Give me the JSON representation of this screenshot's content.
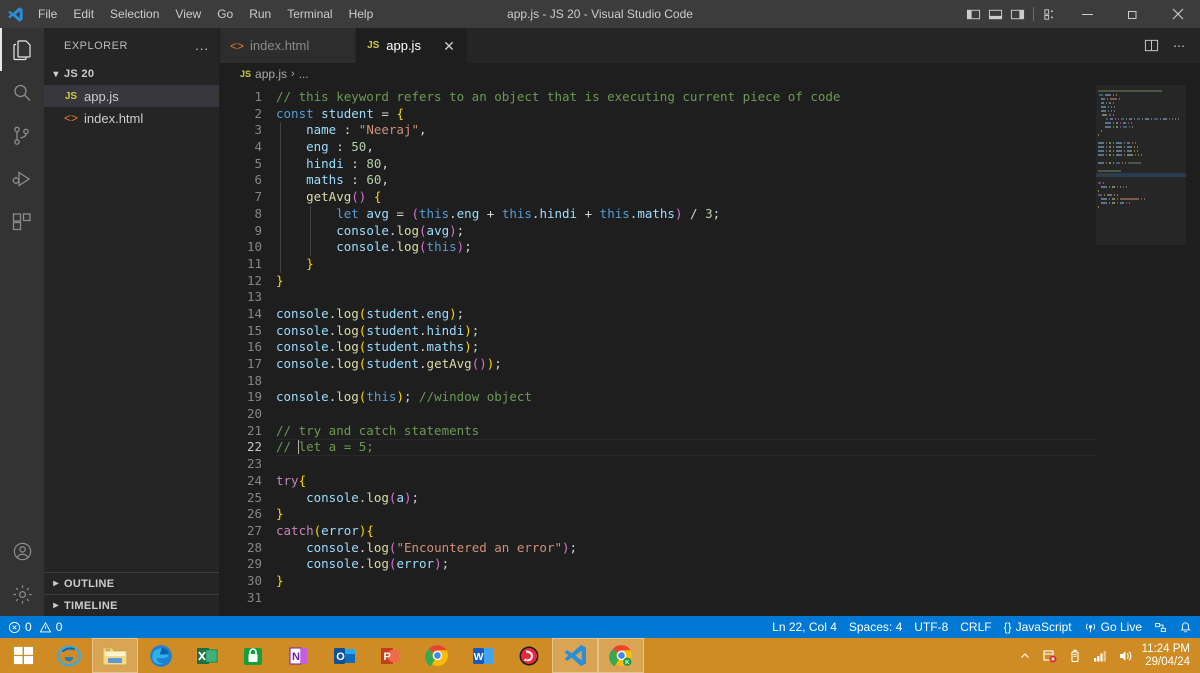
{
  "titlebar": {
    "window_title": "app.js - JS 20 - Visual Studio Code",
    "menus": [
      "File",
      "Edit",
      "Selection",
      "View",
      "Go",
      "Run",
      "Terminal",
      "Help"
    ],
    "layout_buttons": [
      {
        "name": "toggle-primary-sidebar",
        "label": "Toggle Primary Side Bar"
      },
      {
        "name": "toggle-panel",
        "label": "Toggle Panel"
      },
      {
        "name": "toggle-secondary-sidebar",
        "label": "Toggle Secondary Side Bar"
      },
      {
        "name": "customize-layout",
        "label": "Customize Layout"
      }
    ],
    "window_controls": [
      "minimize",
      "maximize",
      "close"
    ]
  },
  "activitybar": {
    "items": [
      {
        "name": "explorer",
        "label": "Explorer",
        "active": true
      },
      {
        "name": "search",
        "label": "Search",
        "active": false
      },
      {
        "name": "source-control",
        "label": "Source Control",
        "active": false
      },
      {
        "name": "run-and-debug",
        "label": "Run and Debug",
        "active": false
      },
      {
        "name": "extensions",
        "label": "Extensions",
        "active": false
      }
    ],
    "bottom": [
      {
        "name": "accounts",
        "label": "Accounts"
      },
      {
        "name": "manage",
        "label": "Manage"
      }
    ]
  },
  "sidebar": {
    "title": "EXPLORER",
    "more_actions": "...",
    "folder": {
      "label": "JS 20",
      "expanded": true
    },
    "files": [
      {
        "label": "app.js",
        "icon": "js",
        "selected": true
      },
      {
        "label": "index.html",
        "icon": "html",
        "selected": false
      }
    ],
    "collapsed_sections": [
      "OUTLINE",
      "TIMELINE"
    ]
  },
  "editor": {
    "tabs": [
      {
        "label": "index.html",
        "icon": "html",
        "active": false
      },
      {
        "label": "app.js",
        "icon": "js",
        "active": true
      }
    ],
    "tab_close": "✕",
    "actions": [
      {
        "name": "split-editor-right",
        "label": "Split Editor Right"
      },
      {
        "name": "more-actions",
        "label": "More Actions..."
      }
    ],
    "breadcrumb": [
      "app.js",
      "..."
    ],
    "total_lines": 31,
    "cursor_line": 22,
    "code_lines": [
      {
        "n": 1,
        "tokens": [
          {
            "t": "// this keyword refers to an object that is executing current piece of code",
            "c": "c-com"
          }
        ]
      },
      {
        "n": 2,
        "tokens": [
          {
            "t": "const",
            "c": "c-kw"
          },
          {
            "t": " "
          },
          {
            "t": "student",
            "c": "c-var"
          },
          {
            "t": " = ",
            "c": "c-op"
          },
          {
            "t": "{",
            "c": "c-b1"
          }
        ]
      },
      {
        "n": 3,
        "tokens": [
          {
            "t": "    "
          },
          {
            "t": "name",
            "c": "c-prop"
          },
          {
            "t": " : ",
            "c": "c-op"
          },
          {
            "t": "\"Neeraj\"",
            "c": "c-str"
          },
          {
            "t": ",",
            "c": "c-op"
          }
        ]
      },
      {
        "n": 4,
        "tokens": [
          {
            "t": "    "
          },
          {
            "t": "eng",
            "c": "c-prop"
          },
          {
            "t": " : ",
            "c": "c-op"
          },
          {
            "t": "50",
            "c": "c-num"
          },
          {
            "t": ",",
            "c": "c-op"
          }
        ]
      },
      {
        "n": 5,
        "tokens": [
          {
            "t": "    "
          },
          {
            "t": "hindi",
            "c": "c-prop"
          },
          {
            "t": " : ",
            "c": "c-op"
          },
          {
            "t": "80",
            "c": "c-num"
          },
          {
            "t": ",",
            "c": "c-op"
          }
        ]
      },
      {
        "n": 6,
        "tokens": [
          {
            "t": "    "
          },
          {
            "t": "maths",
            "c": "c-prop"
          },
          {
            "t": " : ",
            "c": "c-op"
          },
          {
            "t": "60",
            "c": "c-num"
          },
          {
            "t": ",",
            "c": "c-op"
          }
        ]
      },
      {
        "n": 7,
        "tokens": [
          {
            "t": "    "
          },
          {
            "t": "getAvg",
            "c": "c-fn"
          },
          {
            "t": "()",
            "c": "c-b2"
          },
          {
            "t": " "
          },
          {
            "t": "{",
            "c": "c-b1"
          }
        ]
      },
      {
        "n": 8,
        "tokens": [
          {
            "t": "        "
          },
          {
            "t": "let",
            "c": "c-kw"
          },
          {
            "t": " "
          },
          {
            "t": "avg",
            "c": "c-var"
          },
          {
            "t": " = ",
            "c": "c-op"
          },
          {
            "t": "(",
            "c": "c-b2"
          },
          {
            "t": "this",
            "c": "c-this"
          },
          {
            "t": ".",
            "c": "c-op"
          },
          {
            "t": "eng",
            "c": "c-prop"
          },
          {
            "t": " + ",
            "c": "c-op"
          },
          {
            "t": "this",
            "c": "c-this"
          },
          {
            "t": ".",
            "c": "c-op"
          },
          {
            "t": "hindi",
            "c": "c-prop"
          },
          {
            "t": " + ",
            "c": "c-op"
          },
          {
            "t": "this",
            "c": "c-this"
          },
          {
            "t": ".",
            "c": "c-op"
          },
          {
            "t": "maths",
            "c": "c-prop"
          },
          {
            "t": ")",
            "c": "c-b2"
          },
          {
            "t": " / ",
            "c": "c-op"
          },
          {
            "t": "3",
            "c": "c-num"
          },
          {
            "t": ";",
            "c": "c-op"
          }
        ]
      },
      {
        "n": 9,
        "tokens": [
          {
            "t": "        "
          },
          {
            "t": "console",
            "c": "c-var"
          },
          {
            "t": ".",
            "c": "c-op"
          },
          {
            "t": "log",
            "c": "c-fn"
          },
          {
            "t": "(",
            "c": "c-b2"
          },
          {
            "t": "avg",
            "c": "c-var"
          },
          {
            "t": ")",
            "c": "c-b2"
          },
          {
            "t": ";",
            "c": "c-op"
          }
        ]
      },
      {
        "n": 10,
        "tokens": [
          {
            "t": "        "
          },
          {
            "t": "console",
            "c": "c-var"
          },
          {
            "t": ".",
            "c": "c-op"
          },
          {
            "t": "log",
            "c": "c-fn"
          },
          {
            "t": "(",
            "c": "c-b2"
          },
          {
            "t": "this",
            "c": "c-this"
          },
          {
            "t": ")",
            "c": "c-b2"
          },
          {
            "t": ";",
            "c": "c-op"
          }
        ]
      },
      {
        "n": 11,
        "tokens": [
          {
            "t": "    "
          },
          {
            "t": "}",
            "c": "c-b1"
          }
        ]
      },
      {
        "n": 12,
        "tokens": [
          {
            "t": "}",
            "c": "c-b1"
          }
        ]
      },
      {
        "n": 13,
        "tokens": [
          {
            "t": ""
          }
        ]
      },
      {
        "n": 14,
        "tokens": [
          {
            "t": "console",
            "c": "c-var"
          },
          {
            "t": ".",
            "c": "c-op"
          },
          {
            "t": "log",
            "c": "c-fn"
          },
          {
            "t": "(",
            "c": "c-b1"
          },
          {
            "t": "student",
            "c": "c-var"
          },
          {
            "t": ".",
            "c": "c-op"
          },
          {
            "t": "eng",
            "c": "c-prop"
          },
          {
            "t": ")",
            "c": "c-b1"
          },
          {
            "t": ";",
            "c": "c-op"
          }
        ]
      },
      {
        "n": 15,
        "tokens": [
          {
            "t": "console",
            "c": "c-var"
          },
          {
            "t": ".",
            "c": "c-op"
          },
          {
            "t": "log",
            "c": "c-fn"
          },
          {
            "t": "(",
            "c": "c-b1"
          },
          {
            "t": "student",
            "c": "c-var"
          },
          {
            "t": ".",
            "c": "c-op"
          },
          {
            "t": "hindi",
            "c": "c-prop"
          },
          {
            "t": ")",
            "c": "c-b1"
          },
          {
            "t": ";",
            "c": "c-op"
          }
        ]
      },
      {
        "n": 16,
        "tokens": [
          {
            "t": "console",
            "c": "c-var"
          },
          {
            "t": ".",
            "c": "c-op"
          },
          {
            "t": "log",
            "c": "c-fn"
          },
          {
            "t": "(",
            "c": "c-b1"
          },
          {
            "t": "student",
            "c": "c-var"
          },
          {
            "t": ".",
            "c": "c-op"
          },
          {
            "t": "maths",
            "c": "c-prop"
          },
          {
            "t": ")",
            "c": "c-b1"
          },
          {
            "t": ";",
            "c": "c-op"
          }
        ]
      },
      {
        "n": 17,
        "tokens": [
          {
            "t": "console",
            "c": "c-var"
          },
          {
            "t": ".",
            "c": "c-op"
          },
          {
            "t": "log",
            "c": "c-fn"
          },
          {
            "t": "(",
            "c": "c-b1"
          },
          {
            "t": "student",
            "c": "c-var"
          },
          {
            "t": ".",
            "c": "c-op"
          },
          {
            "t": "getAvg",
            "c": "c-fn"
          },
          {
            "t": "()",
            "c": "c-b2"
          },
          {
            "t": ")",
            "c": "c-b1"
          },
          {
            "t": ";",
            "c": "c-op"
          }
        ]
      },
      {
        "n": 18,
        "tokens": [
          {
            "t": ""
          }
        ]
      },
      {
        "n": 19,
        "tokens": [
          {
            "t": "console",
            "c": "c-var"
          },
          {
            "t": ".",
            "c": "c-op"
          },
          {
            "t": "log",
            "c": "c-fn"
          },
          {
            "t": "(",
            "c": "c-b1"
          },
          {
            "t": "this",
            "c": "c-this"
          },
          {
            "t": ")",
            "c": "c-b1"
          },
          {
            "t": "; ",
            "c": "c-op"
          },
          {
            "t": "//window object",
            "c": "c-com"
          }
        ]
      },
      {
        "n": 20,
        "tokens": [
          {
            "t": ""
          }
        ]
      },
      {
        "n": 21,
        "tokens": [
          {
            "t": "// try and catch statements",
            "c": "c-com"
          }
        ]
      },
      {
        "n": 22,
        "tokens": [
          {
            "t": "// ",
            "c": "c-com"
          },
          {
            "t": "CARET"
          },
          {
            "t": "let a = 5;",
            "c": "c-com"
          }
        ]
      },
      {
        "n": 23,
        "tokens": [
          {
            "t": ""
          }
        ]
      },
      {
        "n": 24,
        "tokens": [
          {
            "t": "try",
            "c": "c-kw2"
          },
          {
            "t": "{",
            "c": "c-b1"
          }
        ]
      },
      {
        "n": 25,
        "tokens": [
          {
            "t": "    "
          },
          {
            "t": "console",
            "c": "c-var"
          },
          {
            "t": ".",
            "c": "c-op"
          },
          {
            "t": "log",
            "c": "c-fn"
          },
          {
            "t": "(",
            "c": "c-b2"
          },
          {
            "t": "a",
            "c": "c-var"
          },
          {
            "t": ")",
            "c": "c-b2"
          },
          {
            "t": ";",
            "c": "c-op"
          }
        ]
      },
      {
        "n": 26,
        "tokens": [
          {
            "t": "}",
            "c": "c-b1"
          }
        ]
      },
      {
        "n": 27,
        "tokens": [
          {
            "t": "catch",
            "c": "c-kw2"
          },
          {
            "t": "(",
            "c": "c-b1"
          },
          {
            "t": "error",
            "c": "c-var"
          },
          {
            "t": ")",
            "c": "c-b1"
          },
          {
            "t": "{",
            "c": "c-b1"
          }
        ]
      },
      {
        "n": 28,
        "tokens": [
          {
            "t": "    "
          },
          {
            "t": "console",
            "c": "c-var"
          },
          {
            "t": ".",
            "c": "c-op"
          },
          {
            "t": "log",
            "c": "c-fn"
          },
          {
            "t": "(",
            "c": "c-b2"
          },
          {
            "t": "\"Encountered an error\"",
            "c": "c-str"
          },
          {
            "t": ")",
            "c": "c-b2"
          },
          {
            "t": ";",
            "c": "c-op"
          }
        ]
      },
      {
        "n": 29,
        "tokens": [
          {
            "t": "    "
          },
          {
            "t": "console",
            "c": "c-var"
          },
          {
            "t": ".",
            "c": "c-op"
          },
          {
            "t": "log",
            "c": "c-fn"
          },
          {
            "t": "(",
            "c": "c-b2"
          },
          {
            "t": "error",
            "c": "c-var"
          },
          {
            "t": ")",
            "c": "c-b2"
          },
          {
            "t": ";",
            "c": "c-op"
          }
        ]
      },
      {
        "n": 30,
        "tokens": [
          {
            "t": "}",
            "c": "c-b1"
          }
        ]
      },
      {
        "n": 31,
        "tokens": [
          {
            "t": ""
          }
        ]
      }
    ]
  },
  "statusbar": {
    "errors": "0",
    "warnings": "0",
    "cursor_position": "Ln 22, Col 4",
    "indentation": "Spaces: 4",
    "encoding": "UTF-8",
    "eol": "CRLF",
    "language": "JavaScript",
    "language_prefix": "{}",
    "go_live": "Go Live",
    "right_icons": [
      "remote-icon",
      "bell-icon"
    ],
    "background": "#0078d4"
  },
  "taskbar": {
    "background": "#cf8c24",
    "items": [
      {
        "name": "start-button",
        "label": "Start"
      },
      {
        "name": "internet-explorer",
        "label": "Internet Explorer"
      },
      {
        "name": "file-explorer",
        "label": "File Explorer",
        "running": true
      },
      {
        "name": "microsoft-edge",
        "label": "Microsoft Edge"
      },
      {
        "name": "excel",
        "label": "Excel"
      },
      {
        "name": "microsoft-store",
        "label": "Microsoft Store"
      },
      {
        "name": "onenote",
        "label": "OneNote"
      },
      {
        "name": "outlook",
        "label": "Outlook"
      },
      {
        "name": "powerpoint",
        "label": "PowerPoint"
      },
      {
        "name": "google-chrome",
        "label": "Google Chrome"
      },
      {
        "name": "word",
        "label": "Word"
      },
      {
        "name": "media-app",
        "label": "Media Player"
      },
      {
        "name": "visual-studio-code",
        "label": "Visual Studio Code",
        "running": true
      },
      {
        "name": "chrome-app",
        "label": "Chrome App",
        "running": true
      }
    ],
    "tray": {
      "icons": [
        "show-hidden-icons",
        "security-icon",
        "usb-icon",
        "network-icon",
        "volume-icon"
      ],
      "time": "11:24 PM",
      "date": "29/04/24"
    }
  }
}
